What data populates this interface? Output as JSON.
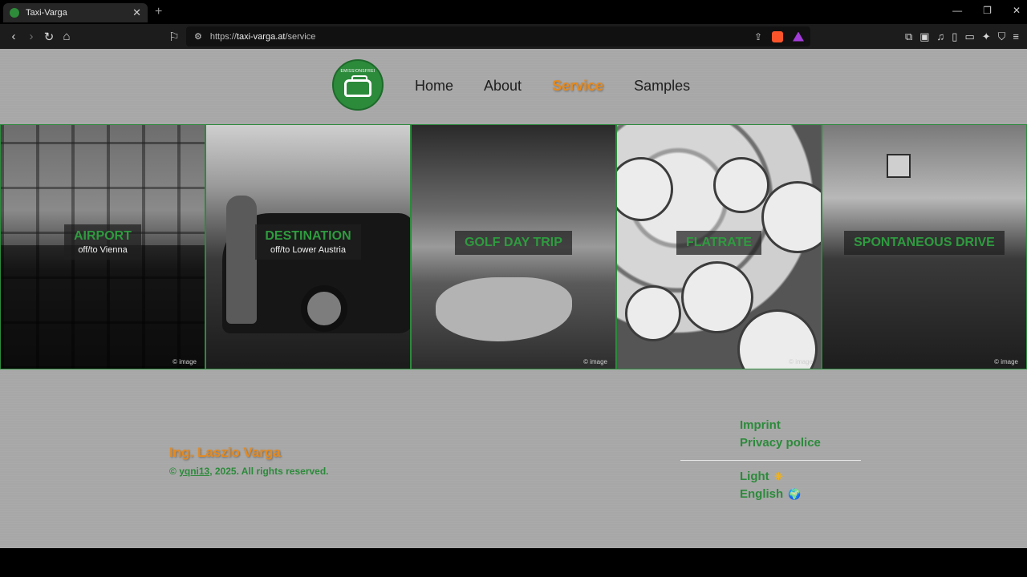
{
  "browser": {
    "tab_title": "Taxi-Varga",
    "tab_close": "✕",
    "new_tab": "+",
    "url_prefix": "https://",
    "url_host": "taxi-varga.at",
    "url_path": "/service",
    "window_buttons": [
      "—",
      "❐",
      "✕"
    ]
  },
  "nav": {
    "logo_text": "EMISSIONSFREI",
    "items": [
      {
        "label": "Home"
      },
      {
        "label": "About"
      },
      {
        "label": "Service"
      },
      {
        "label": "Samples"
      }
    ],
    "active": "Service"
  },
  "tiles": [
    {
      "title": "AIRPORT",
      "subtitle": "off/to Vienna",
      "copyright": "© image"
    },
    {
      "title": "DESTINATION",
      "subtitle": "off/to Lower Austria",
      "copyright": ""
    },
    {
      "title": "GOLF DAY TRIP",
      "subtitle": "",
      "copyright": "© image"
    },
    {
      "title": "FLATRATE",
      "subtitle": "",
      "copyright": "© image"
    },
    {
      "title": "SPONTANEOUS DRIVE",
      "subtitle": "",
      "copyright": "© image"
    }
  ],
  "footer": {
    "owner": "Ing. Laszlo Varga",
    "rights_prefix": "© ",
    "rights_author": "yqni13",
    "rights_suffix": ", 2025. All rights reserved.",
    "links": {
      "imprint": "Imprint",
      "privacy": "Privacy police",
      "theme": "Light",
      "language": "English"
    }
  },
  "colors": {
    "accent_green": "#2c8a3b",
    "accent_orange": "#e58a1f",
    "page_bg": "#a7a7a7"
  }
}
